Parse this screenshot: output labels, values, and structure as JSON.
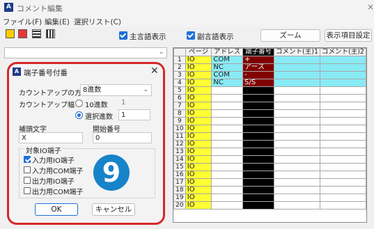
{
  "window": {
    "title": "コメント編集",
    "close": "×"
  },
  "menu": [
    "ファイル(F)",
    "編集(E)",
    "選択リスト(C)"
  ],
  "toolbar": {
    "main_lang": "主言語表示",
    "sub_lang": "副言語表示",
    "zoom": "ズーム",
    "display_settings": "表示項目設定"
  },
  "grid": {
    "headers": [
      "",
      "ページ",
      "アドレス",
      "端子番号",
      "コメント(主)1",
      "コメント(主)2"
    ],
    "rows": [
      {
        "n": "1",
        "page": "IO",
        "addr": "COM",
        "term": "+",
        "hl": true,
        "cyan": true
      },
      {
        "n": "2",
        "page": "IO",
        "addr": "NC",
        "term": "アース",
        "hl": true,
        "cyan": true
      },
      {
        "n": "3",
        "page": "IO",
        "addr": "COM",
        "term": "-",
        "hl": true,
        "cyan": true
      },
      {
        "n": "4",
        "page": "IO",
        "addr": "NC",
        "term": "S/S",
        "hl": true,
        "cyan": true
      },
      {
        "n": "5",
        "page": "IO",
        "addr": "",
        "term": "",
        "hl": false,
        "cyan": false
      },
      {
        "n": "6",
        "page": "IO",
        "addr": "",
        "term": "",
        "hl": false,
        "cyan": false
      },
      {
        "n": "7",
        "page": "IO",
        "addr": "",
        "term": "",
        "hl": false,
        "cyan": false
      },
      {
        "n": "8",
        "page": "IO",
        "addr": "",
        "term": "",
        "hl": false,
        "cyan": false
      },
      {
        "n": "9",
        "page": "IO",
        "addr": "",
        "term": "",
        "hl": false,
        "cyan": false
      },
      {
        "n": "10",
        "page": "IO",
        "addr": "",
        "term": "",
        "hl": false,
        "cyan": false
      },
      {
        "n": "11",
        "page": "IO",
        "addr": "",
        "term": "",
        "hl": false,
        "cyan": false
      },
      {
        "n": "12",
        "page": "IO",
        "addr": "",
        "term": "",
        "hl": false,
        "cyan": false
      },
      {
        "n": "13",
        "page": "IO",
        "addr": "",
        "term": "",
        "hl": false,
        "cyan": false
      },
      {
        "n": "14",
        "page": "IO",
        "addr": "",
        "term": "",
        "hl": false,
        "cyan": false
      },
      {
        "n": "15",
        "page": "IO",
        "addr": "",
        "term": "",
        "hl": false,
        "cyan": false
      },
      {
        "n": "16",
        "page": "IO",
        "addr": "",
        "term": "",
        "hl": false,
        "cyan": false
      },
      {
        "n": "17",
        "page": "IO",
        "addr": "",
        "term": "",
        "hl": false,
        "cyan": false
      },
      {
        "n": "18",
        "page": "IO",
        "addr": "",
        "term": "",
        "hl": false,
        "cyan": false
      },
      {
        "n": "19",
        "page": "IO",
        "addr": "",
        "term": "",
        "hl": false,
        "cyan": false
      },
      {
        "n": "20",
        "page": "IO",
        "addr": "",
        "term": "",
        "hl": false,
        "cyan": false
      }
    ]
  },
  "dialog": {
    "title": "端子番号付番",
    "count_method_label": "カウントアップの方法",
    "count_method_value": "8進数",
    "count_width_label": "カウントアップ幅",
    "decimal_label": "10進数",
    "decimal_value": "1",
    "select_label": "選択進数",
    "select_value": "1",
    "prefix_label": "補頭文字",
    "prefix_value": "X",
    "start_label": "開始番号",
    "start_value": "0",
    "target_label": "対象IO端子",
    "targets": [
      {
        "label": "入力用IO端子",
        "checked": true
      },
      {
        "label": "入力用COM端子",
        "checked": false
      },
      {
        "label": "出力用IO端子",
        "checked": false
      },
      {
        "label": "出力用COM端子",
        "checked": false
      }
    ],
    "ok": "OK",
    "cancel": "キャンセル",
    "badge": "9"
  },
  "colors": {
    "dialog_border": "#d62828",
    "badge": "#1783c9",
    "page_col": "#ffff33",
    "term_hl": "#800000",
    "cyan": "#88eaf4"
  }
}
